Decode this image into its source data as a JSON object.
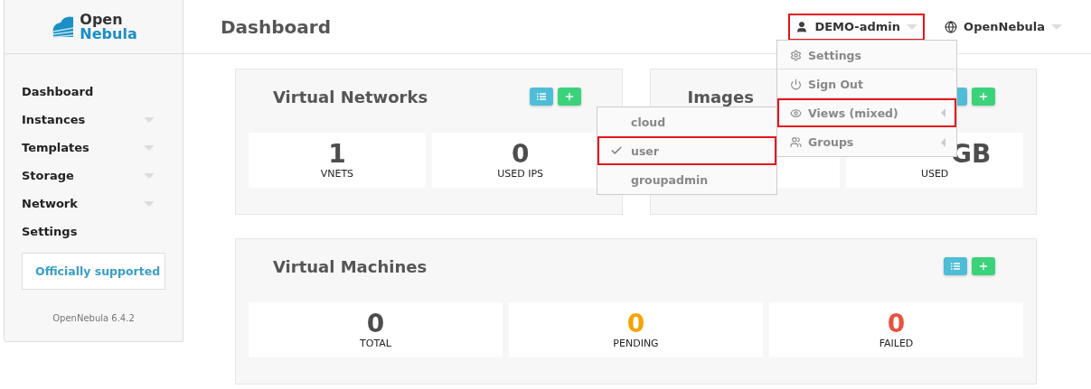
{
  "logo": {
    "line_1": "Open",
    "line_2": "Nebula"
  },
  "sidebar": {
    "items": [
      {
        "label": "Dashboard",
        "expandable": false
      },
      {
        "label": "Instances",
        "expandable": true
      },
      {
        "label": "Templates",
        "expandable": true
      },
      {
        "label": "Storage",
        "expandable": true
      },
      {
        "label": "Network",
        "expandable": true
      },
      {
        "label": "Settings",
        "expandable": false
      }
    ],
    "support_link": "Officially supported",
    "version": "OpenNebula 6.4.2"
  },
  "header": {
    "title": "Dashboard",
    "user": {
      "label": "DEMO-admin",
      "highlighted": true
    },
    "zone": {
      "label": "OpenNebula"
    }
  },
  "cards": [
    {
      "title": "Virtual Networks",
      "stats": [
        {
          "value": "1",
          "label": "VNETS"
        },
        {
          "value": "0",
          "label": "USED IPS"
        }
      ]
    },
    {
      "title": "Images",
      "stats": [
        {
          "value": "GB",
          "label": "USED"
        }
      ]
    },
    {
      "title": "Virtual Machines",
      "stats": [
        {
          "value": "0",
          "label": "TOTAL"
        },
        {
          "value": "0",
          "label": "PENDING",
          "color": "#f5a300"
        },
        {
          "value": "0",
          "label": "FAILED",
          "color": "#e8533f"
        }
      ]
    }
  ],
  "user_menu": {
    "items": [
      {
        "kind": "settings",
        "label": "Settings",
        "submenu": false,
        "highlighted": false
      },
      {
        "kind": "signout",
        "label": "Sign Out",
        "submenu": false,
        "highlighted": false
      },
      {
        "kind": "views",
        "label": "Views (mixed)",
        "submenu": true,
        "highlighted": true
      },
      {
        "kind": "groups",
        "label": "Groups",
        "submenu": true,
        "highlighted": false
      }
    ]
  },
  "views_menu": {
    "items": [
      {
        "label": "cloud",
        "selected": false,
        "highlighted": false
      },
      {
        "label": "user",
        "selected": true,
        "highlighted": true
      },
      {
        "label": "groupadmin",
        "selected": false,
        "highlighted": false
      }
    ]
  }
}
